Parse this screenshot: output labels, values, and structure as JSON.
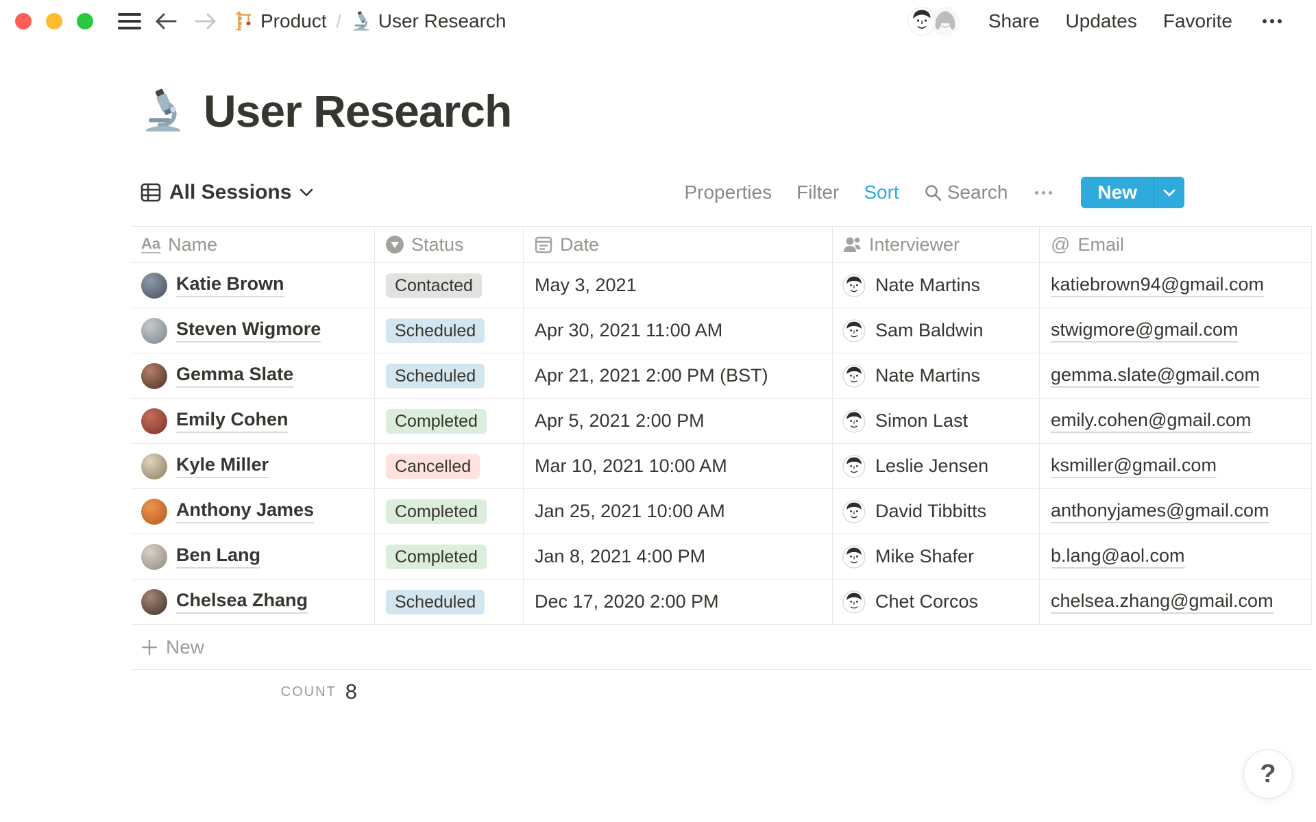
{
  "topbar": {
    "breadcrumb": {
      "items": [
        {
          "icon": "crane-icon",
          "label": "Product"
        },
        {
          "icon": "microscope-icon",
          "label": "User Research"
        }
      ],
      "separator": "/"
    },
    "actions": {
      "share": "Share",
      "updates": "Updates",
      "favorite": "Favorite"
    }
  },
  "page": {
    "icon": "microscope-icon",
    "title": "User Research"
  },
  "toolbar": {
    "view_label": "All Sessions",
    "properties": "Properties",
    "filter": "Filter",
    "sort": "Sort",
    "search": "Search",
    "new": "New"
  },
  "colors": {
    "accent_blue": "#2eaadc",
    "text": "#37352f",
    "traffic_red": "#ff5f57",
    "traffic_yellow": "#febc2e",
    "traffic_green": "#28c840"
  },
  "status_colors": {
    "Contacted": "#e3e2e0",
    "Scheduled": "#d3e5ef",
    "Completed": "#dbeddb",
    "Cancelled": "#ffe2dd"
  },
  "table": {
    "columns": [
      {
        "label": "Name",
        "icon": "text-icon"
      },
      {
        "label": "Status",
        "icon": "select-icon"
      },
      {
        "label": "Date",
        "icon": "calendar-icon"
      },
      {
        "label": "Interviewer",
        "icon": "person-icon"
      },
      {
        "label": "Email",
        "icon": "at-icon"
      }
    ],
    "rows": [
      {
        "name": "Katie Brown",
        "status": "Contacted",
        "date": "May 3, 2021",
        "interviewer": "Nate Martins",
        "email": "katiebrown94@gmail.com",
        "avatar_colors": [
          "#8e99a8",
          "#49505c"
        ]
      },
      {
        "name": "Steven Wigmore",
        "status": "Scheduled",
        "date": "Apr 30, 2021 11:00 AM",
        "interviewer": "Sam Baldwin",
        "email": "stwigmore@gmail.com",
        "avatar_colors": [
          "#c6c9cc",
          "#7d8488"
        ]
      },
      {
        "name": "Gemma Slate",
        "status": "Scheduled",
        "date": "Apr 21, 2021 2:00 PM (BST)",
        "interviewer": "Nate Martins",
        "email": "gemma.slate@gmail.com",
        "avatar_colors": [
          "#b3806a",
          "#4a2f23"
        ]
      },
      {
        "name": "Emily Cohen",
        "status": "Completed",
        "date": "Apr 5, 2021 2:00 PM",
        "interviewer": "Simon Last",
        "email": "emily.cohen@gmail.com",
        "avatar_colors": [
          "#c4705c",
          "#7c2f25"
        ]
      },
      {
        "name": "Kyle Miller",
        "status": "Cancelled",
        "date": "Mar 10, 2021 10:00 AM",
        "interviewer": "Leslie Jensen",
        "email": "ksmiller@gmail.com",
        "avatar_colors": [
          "#e0d4bd",
          "#8a7b5e"
        ]
      },
      {
        "name": "Anthony James",
        "status": "Completed",
        "date": "Jan 25, 2021 10:00 AM",
        "interviewer": "David Tibbitts",
        "email": "anthonyjames@gmail.com",
        "avatar_colors": [
          "#f0944a",
          "#b05a1e"
        ]
      },
      {
        "name": "Ben Lang",
        "status": "Completed",
        "date": "Jan 8, 2021 4:00 PM",
        "interviewer": "Mike Shafer",
        "email": "b.lang@aol.com",
        "avatar_colors": [
          "#d6d0c6",
          "#8f8a80"
        ]
      },
      {
        "name": "Chelsea Zhang",
        "status": "Scheduled",
        "date": "Dec 17, 2020 2:00 PM",
        "interviewer": "Chet Corcos",
        "email": "chelsea.zhang@gmail.com",
        "avatar_colors": [
          "#a58877",
          "#3f2e27"
        ]
      }
    ],
    "new_row_label": "New",
    "footer": {
      "count_label": "COUNT",
      "count_value": "8"
    }
  },
  "help_button": {
    "label": "?"
  }
}
